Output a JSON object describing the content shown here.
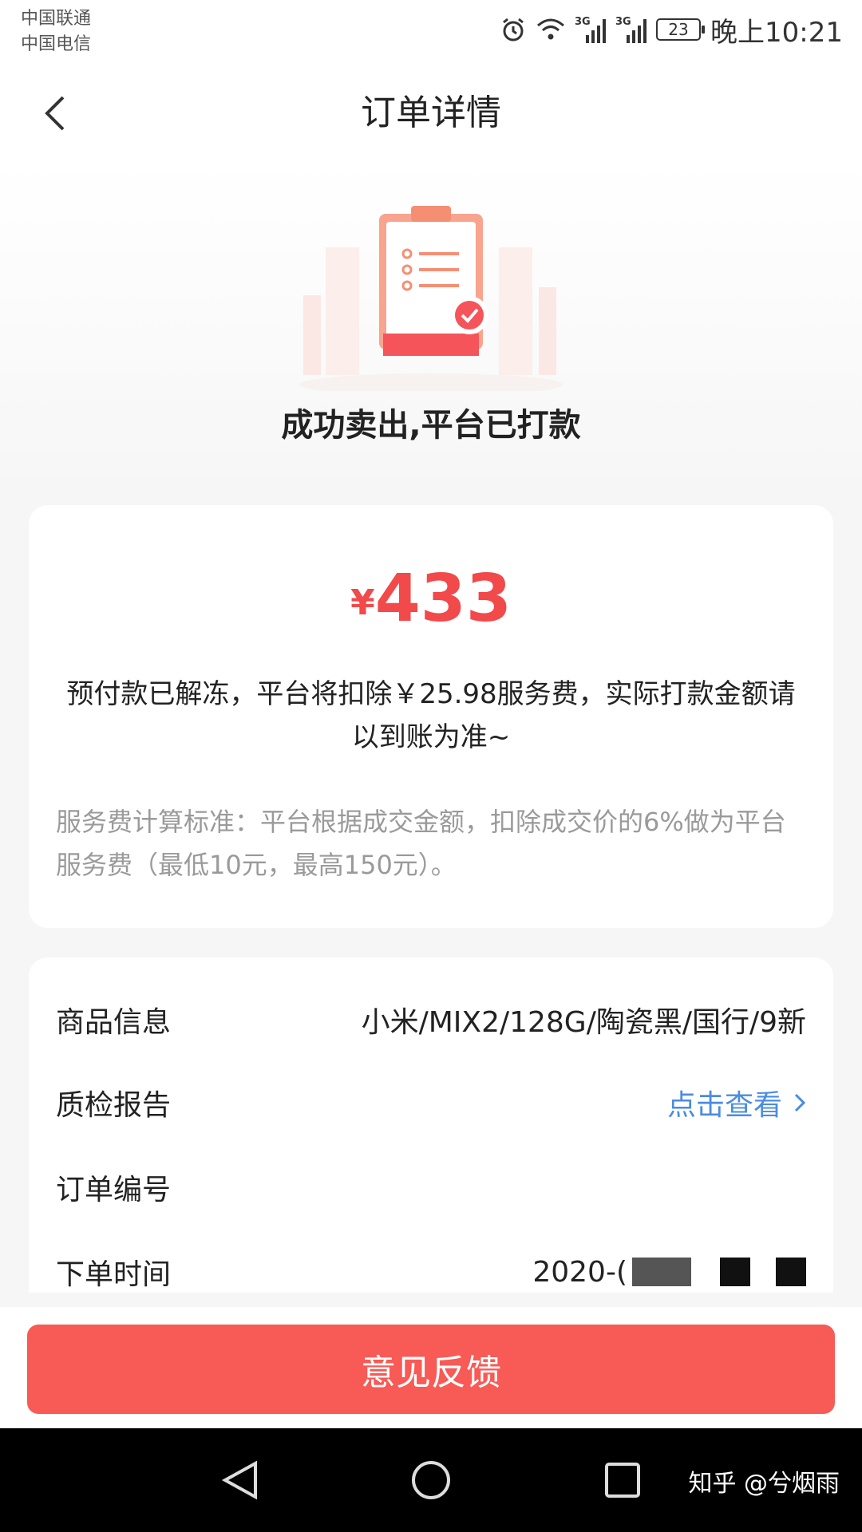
{
  "status_bar": {
    "carrier_1": "中国联通",
    "carrier_2": "中国电信",
    "network_1": "3G",
    "network_2": "3G",
    "battery": "23",
    "time": "晚上10:21"
  },
  "header": {
    "title": "订单详情"
  },
  "hero": {
    "status_text": "成功卖出,平台已打款"
  },
  "amount_card": {
    "currency": "¥",
    "amount": "433",
    "notice": "预付款已解冻，平台将扣除￥25.98服务费，实际打款金额请以到账为准~",
    "fee_rule": "服务费计算标准：平台根据成交金额，扣除成交价的6%做为平台服务费（最低10元，最高150元）。"
  },
  "info": {
    "product_label": "商品信息",
    "product_value": "小米/MIX2/128G/陶瓷黑/国行/9新",
    "report_label": "质检报告",
    "report_value": "点击查看",
    "order_no_label": "订单编号",
    "order_time_label": "下单时间",
    "order_time_value": "2020-("
  },
  "footer": {
    "feedback_label": "意见反馈"
  },
  "watermark": "知乎 @兮烟雨",
  "colors": {
    "accent_red": "#f2494a",
    "button_red": "#f85a55",
    "link_blue": "#4a8ce0"
  }
}
